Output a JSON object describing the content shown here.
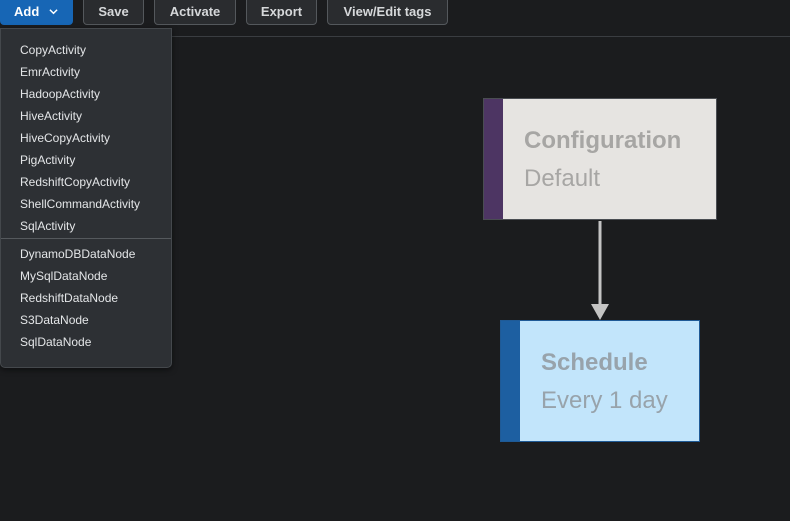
{
  "toolbar": {
    "add_label": "Add",
    "save_label": "Save",
    "activate_label": "Activate",
    "export_label": "Export",
    "tags_label": "View/Edit tags"
  },
  "add_menu": {
    "activities": [
      "CopyActivity",
      "EmrActivity",
      "HadoopActivity",
      "HiveActivity",
      "HiveCopyActivity",
      "PigActivity",
      "RedshiftCopyActivity",
      "ShellCommandActivity",
      "SqlActivity"
    ],
    "data_nodes": [
      "DynamoDBDataNode",
      "MySqlDataNode",
      "RedshiftDataNode",
      "S3DataNode",
      "SqlDataNode"
    ]
  },
  "canvas": {
    "configuration": {
      "title": "Configuration",
      "value": "Default",
      "accent": "#4d3563",
      "fill": "#e6e4e1"
    },
    "schedule": {
      "title": "Schedule",
      "value": "Every 1 day",
      "accent": "#1d5fa1",
      "fill": "#c2e5fb"
    }
  },
  "colors": {
    "primary": "#1766b5",
    "background": "#1b1c1e",
    "menu_bg": "#2d3034",
    "connector": "#c4c4c4"
  },
  "icons": {
    "add_dropdown": "chevron-down-icon",
    "connector_head": "arrow-down-icon"
  }
}
